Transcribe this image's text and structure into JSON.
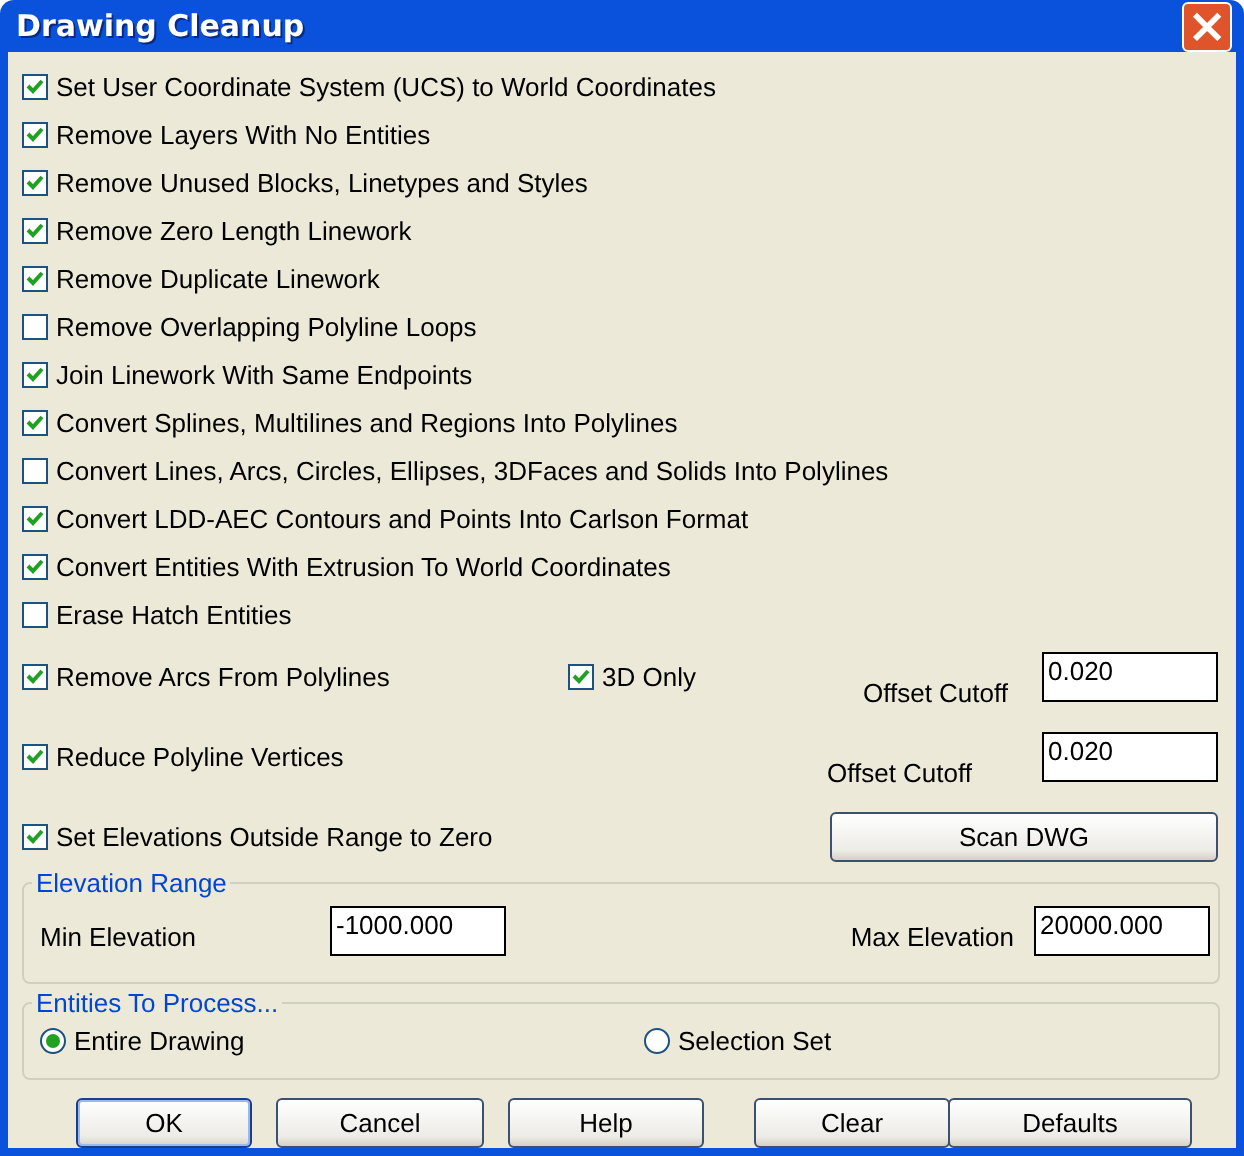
{
  "window": {
    "title": "Drawing Cleanup",
    "close": "×"
  },
  "options": [
    {
      "label": "Set User Coordinate System (UCS) to World Coordinates",
      "checked": true
    },
    {
      "label": "Remove Layers With No Entities",
      "checked": true
    },
    {
      "label": "Remove Unused Blocks, Linetypes and Styles",
      "checked": true
    },
    {
      "label": "Remove Zero Length Linework",
      "checked": true
    },
    {
      "label": "Remove Duplicate Linework",
      "checked": true
    },
    {
      "label": "Remove Overlapping Polyline Loops",
      "checked": false
    },
    {
      "label": "Join Linework With Same Endpoints",
      "checked": true
    },
    {
      "label": "Convert Splines, Multilines and Regions Into Polylines",
      "checked": true
    },
    {
      "label": "Convert Lines, Arcs, Circles, Ellipses, 3DFaces and Solids Into Polylines",
      "checked": false
    },
    {
      "label": "Convert LDD-AEC Contours and Points Into Carlson Format",
      "checked": true
    },
    {
      "label": "Convert Entities With Extrusion To World Coordinates",
      "checked": true
    },
    {
      "label": "Erase Hatch Entities",
      "checked": false
    }
  ],
  "arcs": {
    "label": "Remove Arcs From Polylines",
    "checked": true,
    "three_d": {
      "label": "3D Only",
      "checked": true
    },
    "offset_label": "Offset Cutoff",
    "offset_value": "0.020"
  },
  "vertices": {
    "label": "Reduce Polyline Vertices",
    "checked": true,
    "offset_label": "Offset Cutoff",
    "offset_value": "0.020"
  },
  "elevations": {
    "label": "Set Elevations Outside Range to Zero",
    "checked": true,
    "scan_button": "Scan DWG"
  },
  "elevation_range": {
    "title": "Elevation Range",
    "min_label": "Min Elevation",
    "min_value": "-1000.000",
    "max_label": "Max Elevation",
    "max_value": "20000.000"
  },
  "entities": {
    "title": "Entities To Process...",
    "choices": [
      {
        "label": "Entire Drawing",
        "selected": true
      },
      {
        "label": "Selection Set",
        "selected": false
      }
    ]
  },
  "buttons": [
    {
      "label": "OK",
      "default": true
    },
    {
      "label": "Cancel",
      "default": false
    },
    {
      "label": "Help",
      "default": false
    },
    {
      "label": "Clear",
      "default": false
    },
    {
      "label": "Defaults",
      "default": false
    }
  ]
}
